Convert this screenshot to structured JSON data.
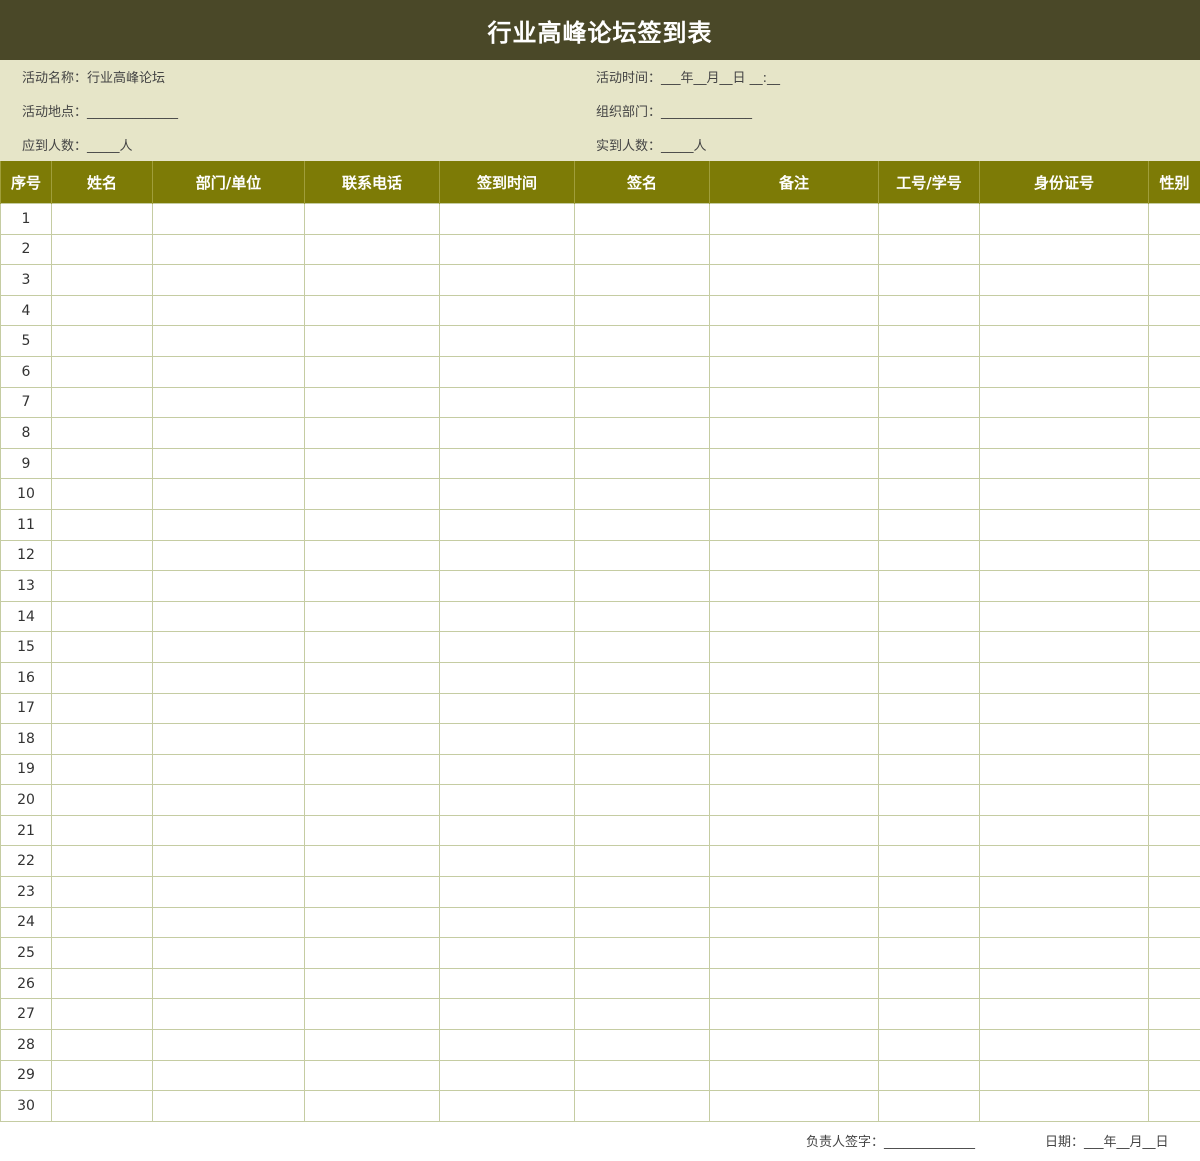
{
  "title": "行业高峰论坛签到表",
  "info": {
    "activity_name": "活动名称：行业高峰论坛",
    "activity_time": "活动时间：___年__月__日  __:__",
    "activity_place": "活动地点：______________",
    "organizer": "组织部门：______________",
    "expected": "应到人数：_____人",
    "actual": "实到人数：_____人"
  },
  "columns": [
    "序号",
    "姓名",
    "部门/单位",
    "联系电话",
    "签到时间",
    "签名",
    "备注",
    "工号/学号",
    "身份证号",
    "性别"
  ],
  "rows": [
    "1",
    "2",
    "3",
    "4",
    "5",
    "6",
    "7",
    "8",
    "9",
    "10",
    "11",
    "12",
    "13",
    "14",
    "15",
    "16",
    "17",
    "18",
    "19",
    "20",
    "21",
    "22",
    "23",
    "24",
    "25",
    "26",
    "27",
    "28",
    "29",
    "30"
  ],
  "footer": {
    "signature": "负责人签字：______________",
    "date": "日期：___年__月__日"
  },
  "colors": {
    "title_bg": "#4a4828",
    "info_bg": "#e6e5c8",
    "header_bg": "#7d7b06",
    "grid": "#c5cca2"
  }
}
